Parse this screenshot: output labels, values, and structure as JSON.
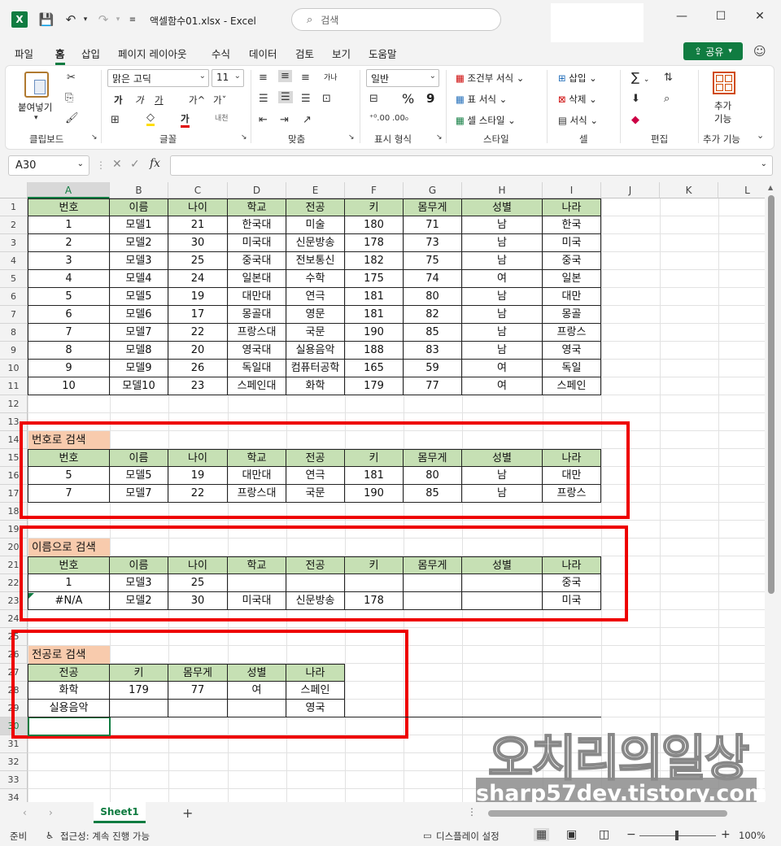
{
  "app": {
    "title": "액셀함수01.xlsx  -  Excel",
    "search_placeholder": "검색",
    "share_label": "공유"
  },
  "menu": [
    "파일",
    "홈",
    "삽입",
    "페이지 레이아웃",
    "수식",
    "데이터",
    "검토",
    "보기",
    "도움말"
  ],
  "ribbon": {
    "clipboard": {
      "paste": "붙여넣기",
      "group": "클립보드"
    },
    "font": {
      "family": "맑은 고딕",
      "size": "11",
      "group": "글꼴",
      "bold": "가",
      "italic": "가",
      "underline": "가",
      "grow": "가^",
      "shrink": "가ˇ",
      "fontcolor": "가",
      "phonetic": "내천"
    },
    "alignment": {
      "group": "맞춤",
      "wrap": "가나"
    },
    "number": {
      "format": "일반",
      "group": "표시 형식",
      "percent": "%",
      "comma": "9"
    },
    "styles": {
      "conditional": "조건부 서식",
      "table": "표 서식",
      "cell": "셀 스타일",
      "group": "스타일"
    },
    "cells": {
      "insert": "삽입",
      "delete": "삭제",
      "format": "서식",
      "group": "셀"
    },
    "editing": {
      "group": "편집",
      "sum": "∑"
    },
    "addins": {
      "label1": "추가",
      "label2": "기능",
      "group": "추가 기능"
    }
  },
  "formula_bar": {
    "name_box": "A30",
    "formula": "",
    "fx": "fx"
  },
  "columns": [
    "A",
    "B",
    "C",
    "D",
    "E",
    "F",
    "G",
    "H",
    "I",
    "J",
    "K",
    "L"
  ],
  "rows": [
    "1",
    "2",
    "3",
    "4",
    "5",
    "6",
    "7",
    "8",
    "9",
    "10",
    "11",
    "12",
    "13",
    "14",
    "15",
    "16",
    "17",
    "18",
    "19",
    "20",
    "21",
    "22",
    "23",
    "24",
    "25",
    "26",
    "27",
    "28",
    "29",
    "30",
    "31",
    "32",
    "33",
    "34"
  ],
  "main_table": {
    "headers": [
      "번호",
      "이름",
      "나이",
      "학교",
      "전공",
      "키",
      "몸무게",
      "성별",
      "나라"
    ],
    "rows": [
      [
        "1",
        "모델1",
        "21",
        "한국대",
        "미술",
        "180",
        "71",
        "남",
        "한국"
      ],
      [
        "2",
        "모델2",
        "30",
        "미국대",
        "신문방송",
        "178",
        "73",
        "남",
        "미국"
      ],
      [
        "3",
        "모델3",
        "25",
        "중국대",
        "전보통신",
        "182",
        "75",
        "남",
        "중국"
      ],
      [
        "4",
        "모델4",
        "24",
        "일본대",
        "수학",
        "175",
        "74",
        "여",
        "일본"
      ],
      [
        "5",
        "모델5",
        "19",
        "대만대",
        "연극",
        "181",
        "80",
        "남",
        "대만"
      ],
      [
        "6",
        "모델6",
        "17",
        "몽골대",
        "영문",
        "181",
        "82",
        "남",
        "몽골"
      ],
      [
        "7",
        "모델7",
        "22",
        "프랑스대",
        "국문",
        "190",
        "85",
        "남",
        "프랑스"
      ],
      [
        "8",
        "모델8",
        "20",
        "영국대",
        "실용음악",
        "188",
        "83",
        "남",
        "영국"
      ],
      [
        "9",
        "모델9",
        "26",
        "독일대",
        "컴퓨터공학",
        "165",
        "59",
        "여",
        "독일"
      ],
      [
        "10",
        "모델10",
        "23",
        "스페인대",
        "화학",
        "179",
        "77",
        "여",
        "스페인"
      ]
    ]
  },
  "search_by_number": {
    "label": "번호로 검색",
    "headers": [
      "번호",
      "이름",
      "나이",
      "학교",
      "전공",
      "키",
      "몸무게",
      "성별",
      "나라"
    ],
    "rows": [
      [
        "5",
        "모델5",
        "19",
        "대만대",
        "연극",
        "181",
        "80",
        "남",
        "대만"
      ],
      [
        "7",
        "모델7",
        "22",
        "프랑스대",
        "국문",
        "190",
        "85",
        "남",
        "프랑스"
      ]
    ]
  },
  "search_by_name": {
    "label": "이름으로 검색",
    "headers": [
      "번호",
      "이름",
      "나이",
      "학교",
      "전공",
      "키",
      "몸무게",
      "성별",
      "나라"
    ],
    "rows": [
      [
        "1",
        "모델3",
        "25",
        "",
        "",
        "",
        "",
        "",
        "중국"
      ],
      [
        "#N/A",
        "모델2",
        "30",
        "미국대",
        "신문방송",
        "178",
        "",
        "",
        "미국"
      ]
    ]
  },
  "search_by_major": {
    "label": "전공로 검색",
    "headers": [
      "전공",
      "키",
      "몸무게",
      "성별",
      "나라"
    ],
    "rows": [
      [
        "화학",
        "179",
        "77",
        "여",
        "스페인"
      ],
      [
        "실용음악",
        "",
        "",
        "",
        "영국"
      ]
    ]
  },
  "sheet_tab": "Sheet1",
  "status": {
    "ready": "준비",
    "accessibility": "접근성: 계속 진행 가능",
    "display": "디스플레이 설정",
    "zoom": "100%"
  },
  "watermark": {
    "line1": "오치리의일상",
    "line2": "sharp57dev.tistory.com"
  },
  "colors": {
    "header_green": "#c6e0b4",
    "label_orange": "#f8cbad",
    "red_box": "#ee0000",
    "excel_green": "#107c41"
  }
}
